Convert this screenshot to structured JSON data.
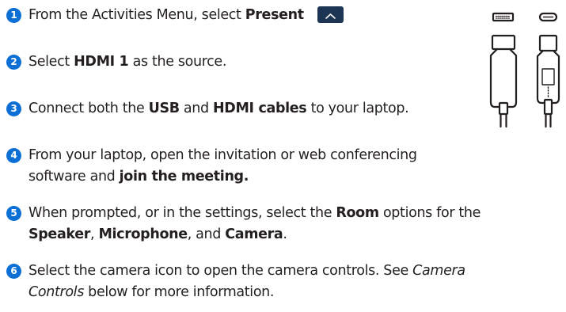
{
  "steps": [
    {
      "number": "1",
      "parts": [
        {
          "text": "From the Activities Menu, select ",
          "style": "normal"
        },
        {
          "text": "Present",
          "style": "bold"
        }
      ],
      "icon": "present-screen-icon"
    },
    {
      "number": "2",
      "parts": [
        {
          "text": "Select ",
          "style": "normal"
        },
        {
          "text": "HDMI 1",
          "style": "bold"
        },
        {
          "text": " as the source.",
          "style": "normal"
        }
      ]
    },
    {
      "number": "3",
      "parts": [
        {
          "text": "Connect both the ",
          "style": "normal"
        },
        {
          "text": "USB",
          "style": "bold"
        },
        {
          "text": " and ",
          "style": "normal"
        },
        {
          "text": "HDMI cables",
          "style": "bold"
        },
        {
          "text": " to your laptop.",
          "style": "normal"
        }
      ]
    },
    {
      "number": "4",
      "parts": [
        {
          "text": "From your laptop, open the invitation or web conferencing",
          "style": "normal"
        },
        {
          "text": "",
          "style": "break"
        },
        {
          "text": "software and ",
          "style": "normal"
        },
        {
          "text": "join the meeting.",
          "style": "bold"
        }
      ]
    },
    {
      "number": "5",
      "parts": [
        {
          "text": "When prompted, or in the settings, select the ",
          "style": "normal"
        },
        {
          "text": "Room",
          "style": "bold"
        },
        {
          "text": " options for the",
          "style": "normal"
        },
        {
          "text": "",
          "style": "break"
        },
        {
          "text": "Speaker",
          "style": "bold"
        },
        {
          "text": ", ",
          "style": "normal"
        },
        {
          "text": "Microphone",
          "style": "bold"
        },
        {
          "text": ", and ",
          "style": "normal"
        },
        {
          "text": "Camera",
          "style": "bold"
        },
        {
          "text": ".",
          "style": "normal"
        }
      ]
    },
    {
      "number": "6",
      "parts": [
        {
          "text": "Select the camera icon to open the camera controls.  See ",
          "style": "normal"
        },
        {
          "text": "Camera",
          "style": "italic"
        },
        {
          "text": "",
          "style": "break"
        },
        {
          "text": "Controls",
          "style": "italic"
        },
        {
          "text": " below for more information.",
          "style": "normal"
        }
      ]
    }
  ],
  "illustration": {
    "icons": [
      "hdmi-cable-icon",
      "usb-cable-icon"
    ]
  },
  "colors": {
    "badge": "#0b6fd6",
    "text": "#231f20",
    "present_icon": "#1b3552",
    "cable_stroke": "#231f20"
  }
}
